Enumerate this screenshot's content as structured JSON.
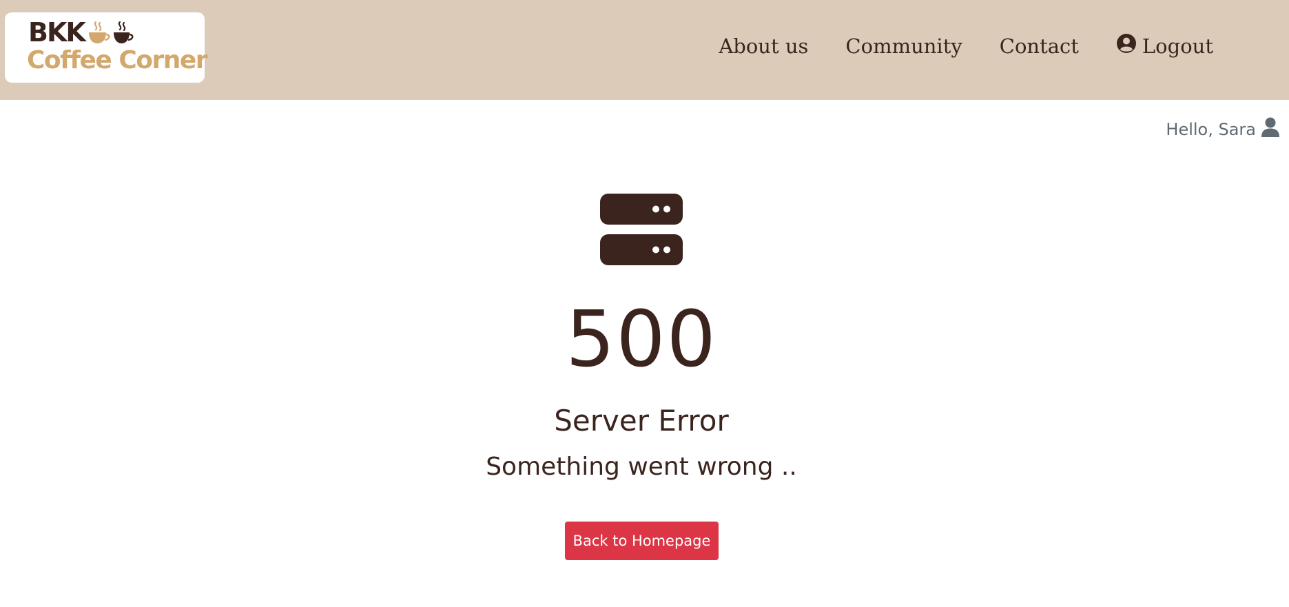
{
  "header": {
    "logo": {
      "line1": "BKK",
      "line2": "Coffee Corner"
    },
    "nav": [
      {
        "label": "About us"
      },
      {
        "label": "Community"
      },
      {
        "label": "Contact"
      },
      {
        "label": "Logout",
        "icon": "user-circle-icon"
      }
    ]
  },
  "user": {
    "greeting": "Hello, Sara",
    "icon": "user-icon"
  },
  "error": {
    "icon": "server-icon",
    "code": "500",
    "title": "Server Error",
    "message": "Something went wrong ..",
    "button_label": "Back to Homepage"
  },
  "colors": {
    "navbar_bg": "#dbcbb8",
    "brand_dark": "#3b241e",
    "brand_gold": "#d4a86c",
    "button_red": "#dc3545",
    "greeting_gray": "#5f6a73"
  }
}
